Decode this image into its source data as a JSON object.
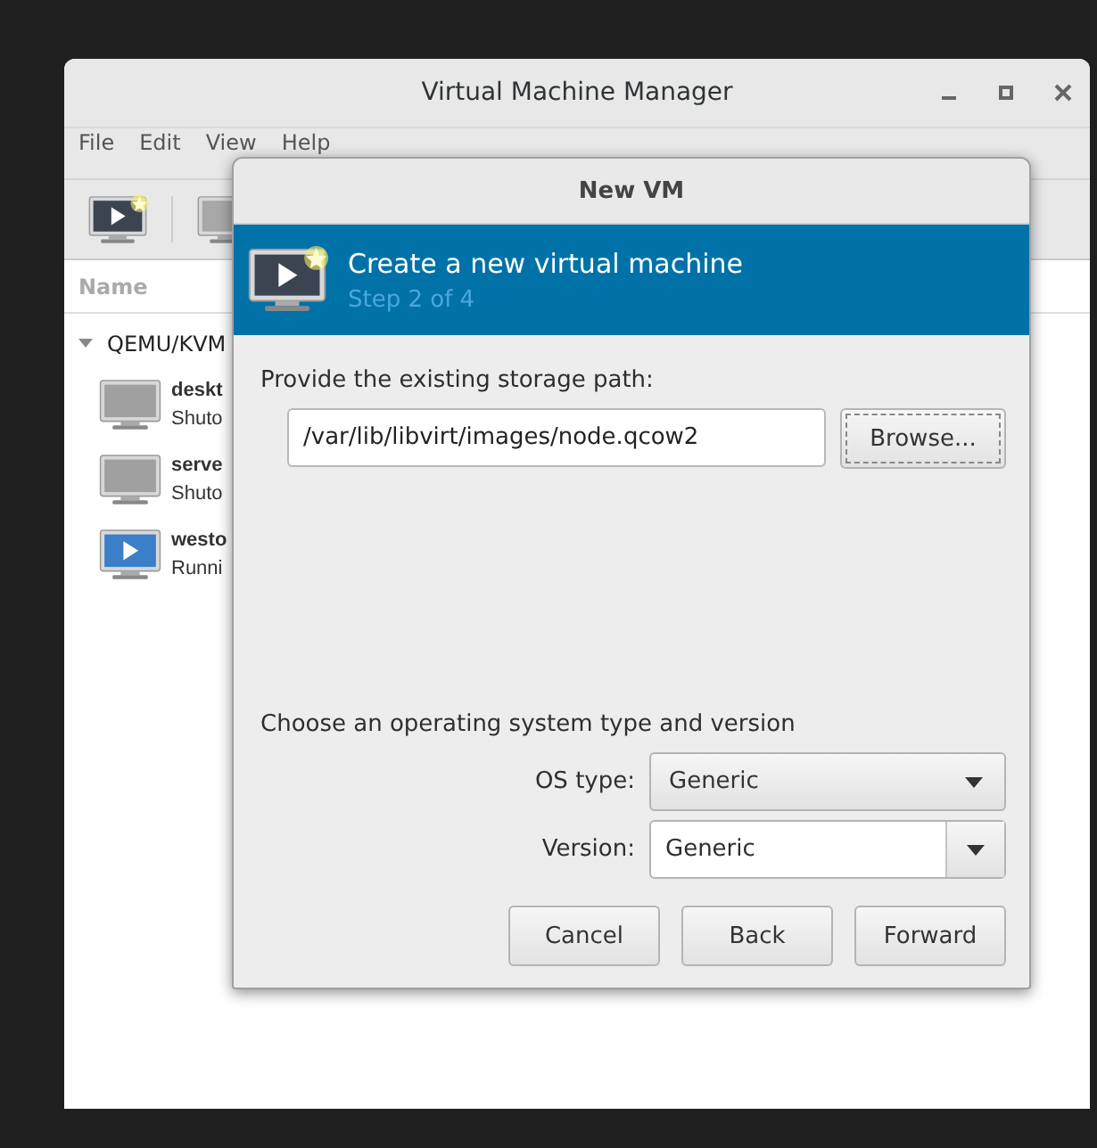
{
  "window": {
    "title": "Virtual Machine Manager"
  },
  "menu": [
    "File",
    "Edit",
    "View",
    "Help"
  ],
  "list": {
    "column": "Name",
    "groups": [
      {
        "label": "QEMU/KVM",
        "expanded": true,
        "children": [
          {
            "name": "deskt",
            "status": "Shuto",
            "running": false
          },
          {
            "name": "serve",
            "status": "Shuto",
            "running": false
          },
          {
            "name": "westo",
            "status": "Runni",
            "running": true
          }
        ]
      }
    ]
  },
  "dialog": {
    "title": "New VM",
    "header": {
      "title": "Create a new virtual machine",
      "step": "Step 2 of 4"
    },
    "storage": {
      "label": "Provide the existing storage path:",
      "value": "/var/lib/libvirt/images/node.qcow2",
      "browse": {
        "label": "Browse...",
        "focused": true
      }
    },
    "os": {
      "label": "Choose an operating system type and version",
      "fields": [
        {
          "label": "OS type:",
          "value": "Generic",
          "kind": "combo"
        },
        {
          "label": "Version:",
          "value": "Generic",
          "kind": "entry"
        }
      ]
    },
    "buttons": [
      "Cancel",
      "Back",
      "Forward"
    ]
  }
}
